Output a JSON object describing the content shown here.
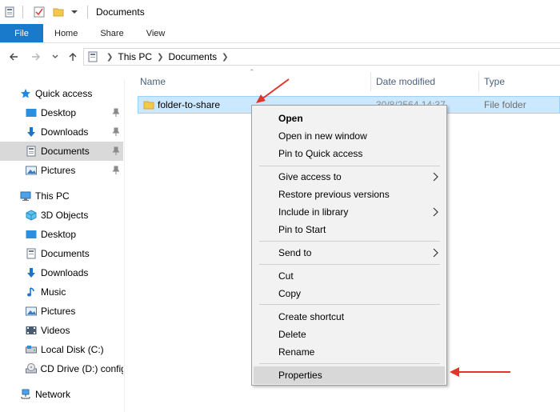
{
  "titlebar": {
    "title": "Documents"
  },
  "ribbon": {
    "file": "File",
    "tabs": [
      "Home",
      "Share",
      "View"
    ]
  },
  "address": {
    "crumbs": [
      "This PC",
      "Documents"
    ]
  },
  "nav": {
    "quick_access": "Quick access",
    "qa_items": [
      "Desktop",
      "Downloads",
      "Documents",
      "Pictures"
    ],
    "this_pc": "This PC",
    "pc_items": [
      "3D Objects",
      "Desktop",
      "Documents",
      "Downloads",
      "Music",
      "Pictures",
      "Videos",
      "Local Disk (C:)",
      "CD Drive (D:) config"
    ],
    "network": "Network"
  },
  "columns": {
    "name": "Name",
    "date": "Date modified",
    "type": "Type"
  },
  "file": {
    "name": "folder-to-share",
    "date": "30/8/2564 14:37",
    "type": "File folder"
  },
  "menu": {
    "open": "Open",
    "open_new_window": "Open in new window",
    "pin_quick_access": "Pin to Quick access",
    "give_access": "Give access to",
    "restore": "Restore previous versions",
    "include_library": "Include in library",
    "pin_start": "Pin to Start",
    "send_to": "Send to",
    "cut": "Cut",
    "copy": "Copy",
    "create_shortcut": "Create shortcut",
    "delete": "Delete",
    "rename": "Rename",
    "properties": "Properties"
  },
  "colors": {
    "accent": "#1979ca",
    "selection": "#cce8ff",
    "annotation": "#e2352a"
  }
}
